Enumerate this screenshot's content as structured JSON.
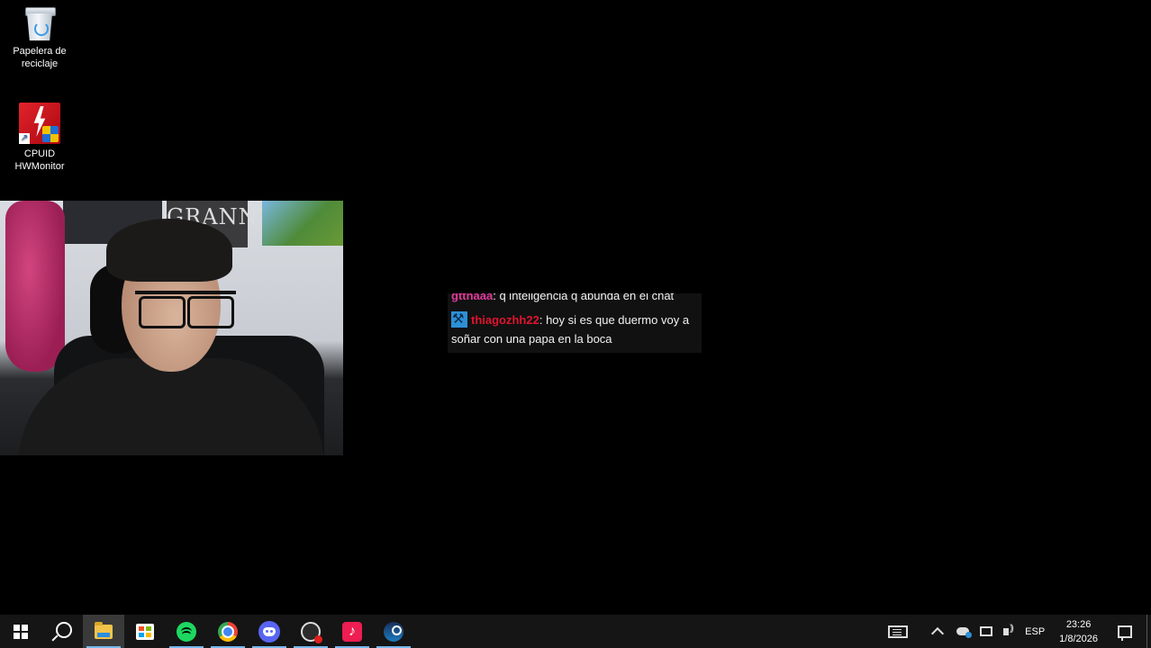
{
  "desktop": {
    "icons": [
      {
        "label": "Papelera de reciclaje",
        "icon": "recycle-bin-icon"
      },
      {
        "label": "CPUID HWMonitor",
        "icon": "hwmonitor-icon"
      }
    ]
  },
  "webcam": {
    "poster_text": "GRANNY"
  },
  "chat": {
    "messages": [
      {
        "user": "gtthaaa",
        "text": ": q inteligencia q abunda en el chat"
      },
      {
        "user": "thiagozhh22",
        "text": ": hoy si es que duermo voy a soñar con una papa en la boca",
        "badge": "moderator-badge-icon"
      }
    ],
    "colors": {
      "user1": "#e0399a",
      "user2": "#e0142e"
    }
  },
  "taskbar": {
    "apps": [
      "start-icon",
      "search-icon",
      "file-explorer-icon",
      "microsoft-store-icon",
      "spotify-icon",
      "chrome-icon",
      "discord-icon",
      "obs-icon",
      "tiktok-icon",
      "steam-icon"
    ],
    "tray": {
      "language": "ESP",
      "time": "23:26",
      "date": "1/8/2026"
    }
  }
}
